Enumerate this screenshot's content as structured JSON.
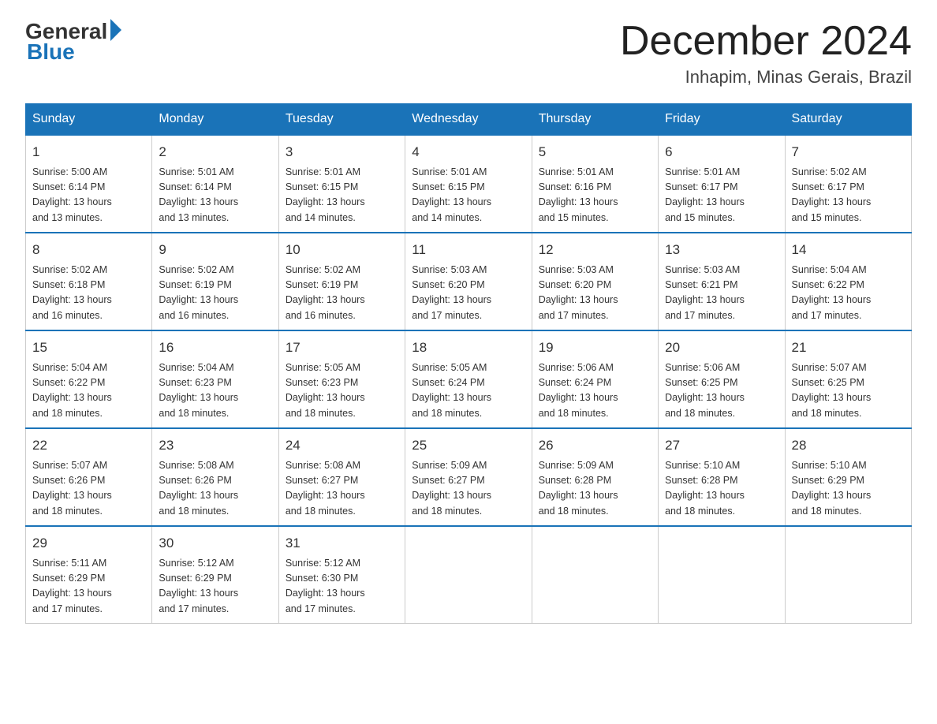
{
  "logo": {
    "general": "General",
    "blue": "Blue"
  },
  "title": "December 2024",
  "location": "Inhapim, Minas Gerais, Brazil",
  "headers": [
    "Sunday",
    "Monday",
    "Tuesday",
    "Wednesday",
    "Thursday",
    "Friday",
    "Saturday"
  ],
  "weeks": [
    [
      {
        "day": "1",
        "info": "Sunrise: 5:00 AM\nSunset: 6:14 PM\nDaylight: 13 hours\nand 13 minutes."
      },
      {
        "day": "2",
        "info": "Sunrise: 5:01 AM\nSunset: 6:14 PM\nDaylight: 13 hours\nand 13 minutes."
      },
      {
        "day": "3",
        "info": "Sunrise: 5:01 AM\nSunset: 6:15 PM\nDaylight: 13 hours\nand 14 minutes."
      },
      {
        "day": "4",
        "info": "Sunrise: 5:01 AM\nSunset: 6:15 PM\nDaylight: 13 hours\nand 14 minutes."
      },
      {
        "day": "5",
        "info": "Sunrise: 5:01 AM\nSunset: 6:16 PM\nDaylight: 13 hours\nand 15 minutes."
      },
      {
        "day": "6",
        "info": "Sunrise: 5:01 AM\nSunset: 6:17 PM\nDaylight: 13 hours\nand 15 minutes."
      },
      {
        "day": "7",
        "info": "Sunrise: 5:02 AM\nSunset: 6:17 PM\nDaylight: 13 hours\nand 15 minutes."
      }
    ],
    [
      {
        "day": "8",
        "info": "Sunrise: 5:02 AM\nSunset: 6:18 PM\nDaylight: 13 hours\nand 16 minutes."
      },
      {
        "day": "9",
        "info": "Sunrise: 5:02 AM\nSunset: 6:19 PM\nDaylight: 13 hours\nand 16 minutes."
      },
      {
        "day": "10",
        "info": "Sunrise: 5:02 AM\nSunset: 6:19 PM\nDaylight: 13 hours\nand 16 minutes."
      },
      {
        "day": "11",
        "info": "Sunrise: 5:03 AM\nSunset: 6:20 PM\nDaylight: 13 hours\nand 17 minutes."
      },
      {
        "day": "12",
        "info": "Sunrise: 5:03 AM\nSunset: 6:20 PM\nDaylight: 13 hours\nand 17 minutes."
      },
      {
        "day": "13",
        "info": "Sunrise: 5:03 AM\nSunset: 6:21 PM\nDaylight: 13 hours\nand 17 minutes."
      },
      {
        "day": "14",
        "info": "Sunrise: 5:04 AM\nSunset: 6:22 PM\nDaylight: 13 hours\nand 17 minutes."
      }
    ],
    [
      {
        "day": "15",
        "info": "Sunrise: 5:04 AM\nSunset: 6:22 PM\nDaylight: 13 hours\nand 18 minutes."
      },
      {
        "day": "16",
        "info": "Sunrise: 5:04 AM\nSunset: 6:23 PM\nDaylight: 13 hours\nand 18 minutes."
      },
      {
        "day": "17",
        "info": "Sunrise: 5:05 AM\nSunset: 6:23 PM\nDaylight: 13 hours\nand 18 minutes."
      },
      {
        "day": "18",
        "info": "Sunrise: 5:05 AM\nSunset: 6:24 PM\nDaylight: 13 hours\nand 18 minutes."
      },
      {
        "day": "19",
        "info": "Sunrise: 5:06 AM\nSunset: 6:24 PM\nDaylight: 13 hours\nand 18 minutes."
      },
      {
        "day": "20",
        "info": "Sunrise: 5:06 AM\nSunset: 6:25 PM\nDaylight: 13 hours\nand 18 minutes."
      },
      {
        "day": "21",
        "info": "Sunrise: 5:07 AM\nSunset: 6:25 PM\nDaylight: 13 hours\nand 18 minutes."
      }
    ],
    [
      {
        "day": "22",
        "info": "Sunrise: 5:07 AM\nSunset: 6:26 PM\nDaylight: 13 hours\nand 18 minutes."
      },
      {
        "day": "23",
        "info": "Sunrise: 5:08 AM\nSunset: 6:26 PM\nDaylight: 13 hours\nand 18 minutes."
      },
      {
        "day": "24",
        "info": "Sunrise: 5:08 AM\nSunset: 6:27 PM\nDaylight: 13 hours\nand 18 minutes."
      },
      {
        "day": "25",
        "info": "Sunrise: 5:09 AM\nSunset: 6:27 PM\nDaylight: 13 hours\nand 18 minutes."
      },
      {
        "day": "26",
        "info": "Sunrise: 5:09 AM\nSunset: 6:28 PM\nDaylight: 13 hours\nand 18 minutes."
      },
      {
        "day": "27",
        "info": "Sunrise: 5:10 AM\nSunset: 6:28 PM\nDaylight: 13 hours\nand 18 minutes."
      },
      {
        "day": "28",
        "info": "Sunrise: 5:10 AM\nSunset: 6:29 PM\nDaylight: 13 hours\nand 18 minutes."
      }
    ],
    [
      {
        "day": "29",
        "info": "Sunrise: 5:11 AM\nSunset: 6:29 PM\nDaylight: 13 hours\nand 17 minutes."
      },
      {
        "day": "30",
        "info": "Sunrise: 5:12 AM\nSunset: 6:29 PM\nDaylight: 13 hours\nand 17 minutes."
      },
      {
        "day": "31",
        "info": "Sunrise: 5:12 AM\nSunset: 6:30 PM\nDaylight: 13 hours\nand 17 minutes."
      },
      {
        "day": "",
        "info": ""
      },
      {
        "day": "",
        "info": ""
      },
      {
        "day": "",
        "info": ""
      },
      {
        "day": "",
        "info": ""
      }
    ]
  ]
}
